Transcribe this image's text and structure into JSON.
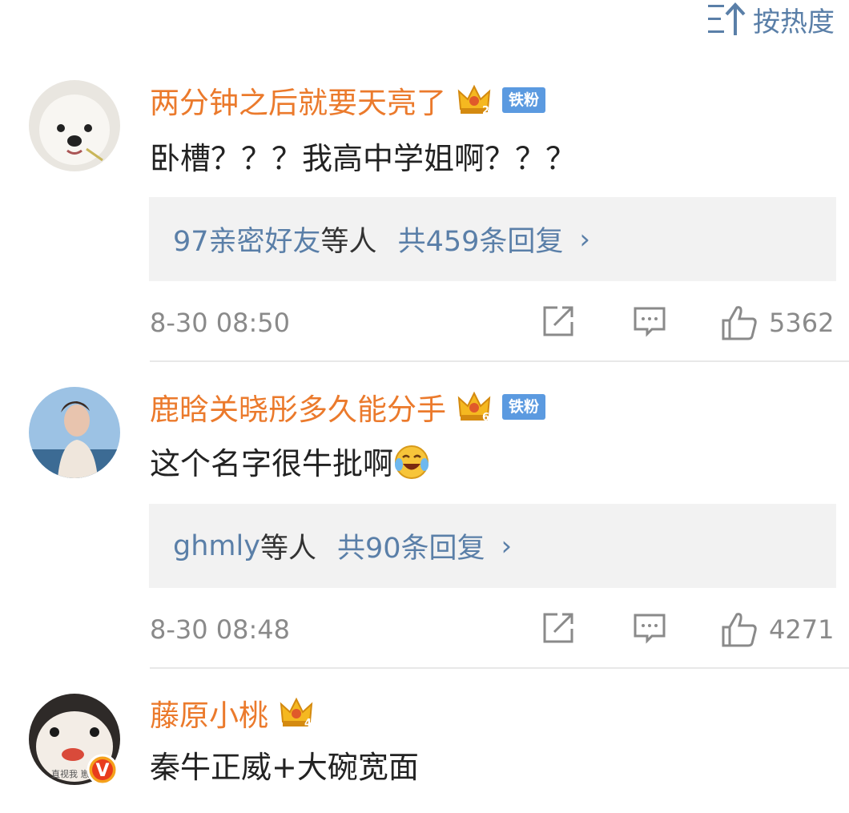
{
  "sort": {
    "label": "按热度"
  },
  "comments": [
    {
      "username": "两分钟之后就要天亮了",
      "crown_level": "2",
      "fan_badge": "铁粉",
      "text": "卧槽？？？我高中学姐啊？？？",
      "reply_names": "97亲密好友",
      "reply_etc": "等人",
      "reply_count": "共459条回复",
      "time": "8-30 08:50",
      "likes": "5362"
    },
    {
      "username": "鹿晗关晓彤多久能分手",
      "crown_level": "6",
      "fan_badge": "铁粉",
      "text": "这个名字很牛批啊",
      "emoji": "laugh-cry-emoji",
      "reply_names": "ghmly",
      "reply_etc": "等人",
      "reply_count": "共90条回复",
      "time": "8-30 08:48",
      "likes": "4271"
    },
    {
      "username": "藤原小桃",
      "crown_level": "4",
      "text": "秦牛正威+大碗宽面",
      "avatar_caption": "直视我 崽",
      "verified": "V"
    }
  ],
  "icons": {
    "sort": "sort-up-icon",
    "share": "share-icon",
    "comment": "comment-icon",
    "like": "thumbs-up-icon",
    "crown": "crown-icon"
  },
  "colors": {
    "username": "#eb7a2c",
    "link": "#5a7fa8",
    "badge": "#5b9ae0",
    "meta": "#8a8a8a",
    "reply_bg": "#f2f2f2"
  }
}
